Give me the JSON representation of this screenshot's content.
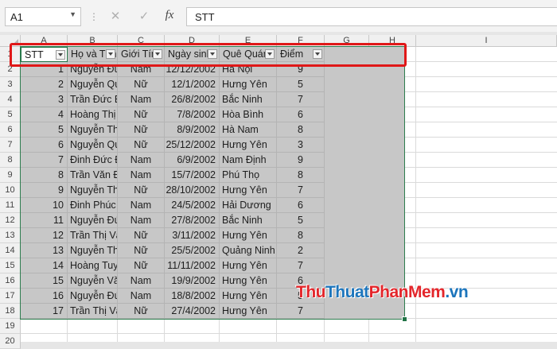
{
  "name_box": {
    "value": "A1"
  },
  "formula_bar": {
    "value": "STT"
  },
  "columns": [
    "A",
    "B",
    "C",
    "D",
    "E",
    "F",
    "G",
    "H",
    "I"
  ],
  "row_numbers": [
    "1",
    "2",
    "3",
    "4",
    "5",
    "6",
    "7",
    "8",
    "9",
    "10",
    "11",
    "12",
    "13",
    "14",
    "15",
    "16",
    "17",
    "18",
    "19",
    "20"
  ],
  "table": {
    "headers": [
      "STT",
      "Họ và Tên",
      "Giới Tính",
      "Ngày sinh",
      "Quê Quán",
      "Điểm"
    ],
    "rows": [
      [
        "1",
        "Nguyễn Đức An",
        "Nam",
        "12/12/2002",
        "Hà Nội",
        "9"
      ],
      [
        "2",
        "Nguyễn Quỳnh Anh",
        "Nữ",
        "12/1/2002",
        "Hưng Yên",
        "5"
      ],
      [
        "3",
        "Trần Đức Bình",
        "Nam",
        "26/8/2002",
        "Bắc Ninh",
        "7"
      ],
      [
        "4",
        "Hoàng Thị Ban",
        "Nữ",
        "7/8/2002",
        "Hòa Bình",
        "6"
      ],
      [
        "5",
        "Nguyễn Thùy Châm",
        "Nữ",
        "8/9/2002",
        "Hà Nam",
        "8"
      ],
      [
        "6",
        "Nguyễn Quỳnh Anh",
        "Nữ",
        "25/12/2002",
        "Hưng Yên",
        "3"
      ],
      [
        "7",
        "Đinh Đức Đạt",
        "Nam",
        "6/9/2002",
        "Nam Định",
        "9"
      ],
      [
        "8",
        "Trần Văn Định",
        "Nam",
        "15/7/2002",
        "Phú Thọ",
        "8"
      ],
      [
        "9",
        "Nguyễn Thu Hà",
        "Nữ",
        "28/10/2002",
        "Hưng Yên",
        "7"
      ],
      [
        "10",
        "Đinh Phúc Hoàng",
        "Nam",
        "24/5/2002",
        "Hải Dương",
        "6"
      ],
      [
        "11",
        "Nguyễn Đức Kiên",
        "Nam",
        "27/8/2002",
        "Bắc Ninh",
        "5"
      ],
      [
        "12",
        "Trần Thị Vân",
        "Nữ",
        "3/11/2002",
        "Hưng Yên",
        "8"
      ],
      [
        "13",
        "Nguyễn Thị Lan",
        "Nữ",
        "25/5/2002",
        "Quảng Ninh",
        "2"
      ],
      [
        "14",
        "Hoàng Tuyết Mai",
        "Nữ",
        "11/11/2002",
        "Hưng Yên",
        "7"
      ],
      [
        "15",
        "Nguyễn Văn Nam",
        "Nam",
        "19/9/2002",
        "Hưng Yên",
        "6"
      ],
      [
        "16",
        "Nguyễn Đức Tú",
        "Nam",
        "18/8/2002",
        "Hưng Yên",
        "5"
      ],
      [
        "17",
        "Trần Thị Vân",
        "Nữ",
        "27/4/2002",
        "Hưng Yên",
        "7"
      ]
    ]
  },
  "watermark": {
    "part1": "Thu",
    "part2": "Thuat",
    "part3": "PhanMem",
    "part4": ".vn"
  },
  "colors": {
    "table_fill": "#c7c7c7",
    "highlight": "#e01818",
    "excel_green": "#217346"
  }
}
